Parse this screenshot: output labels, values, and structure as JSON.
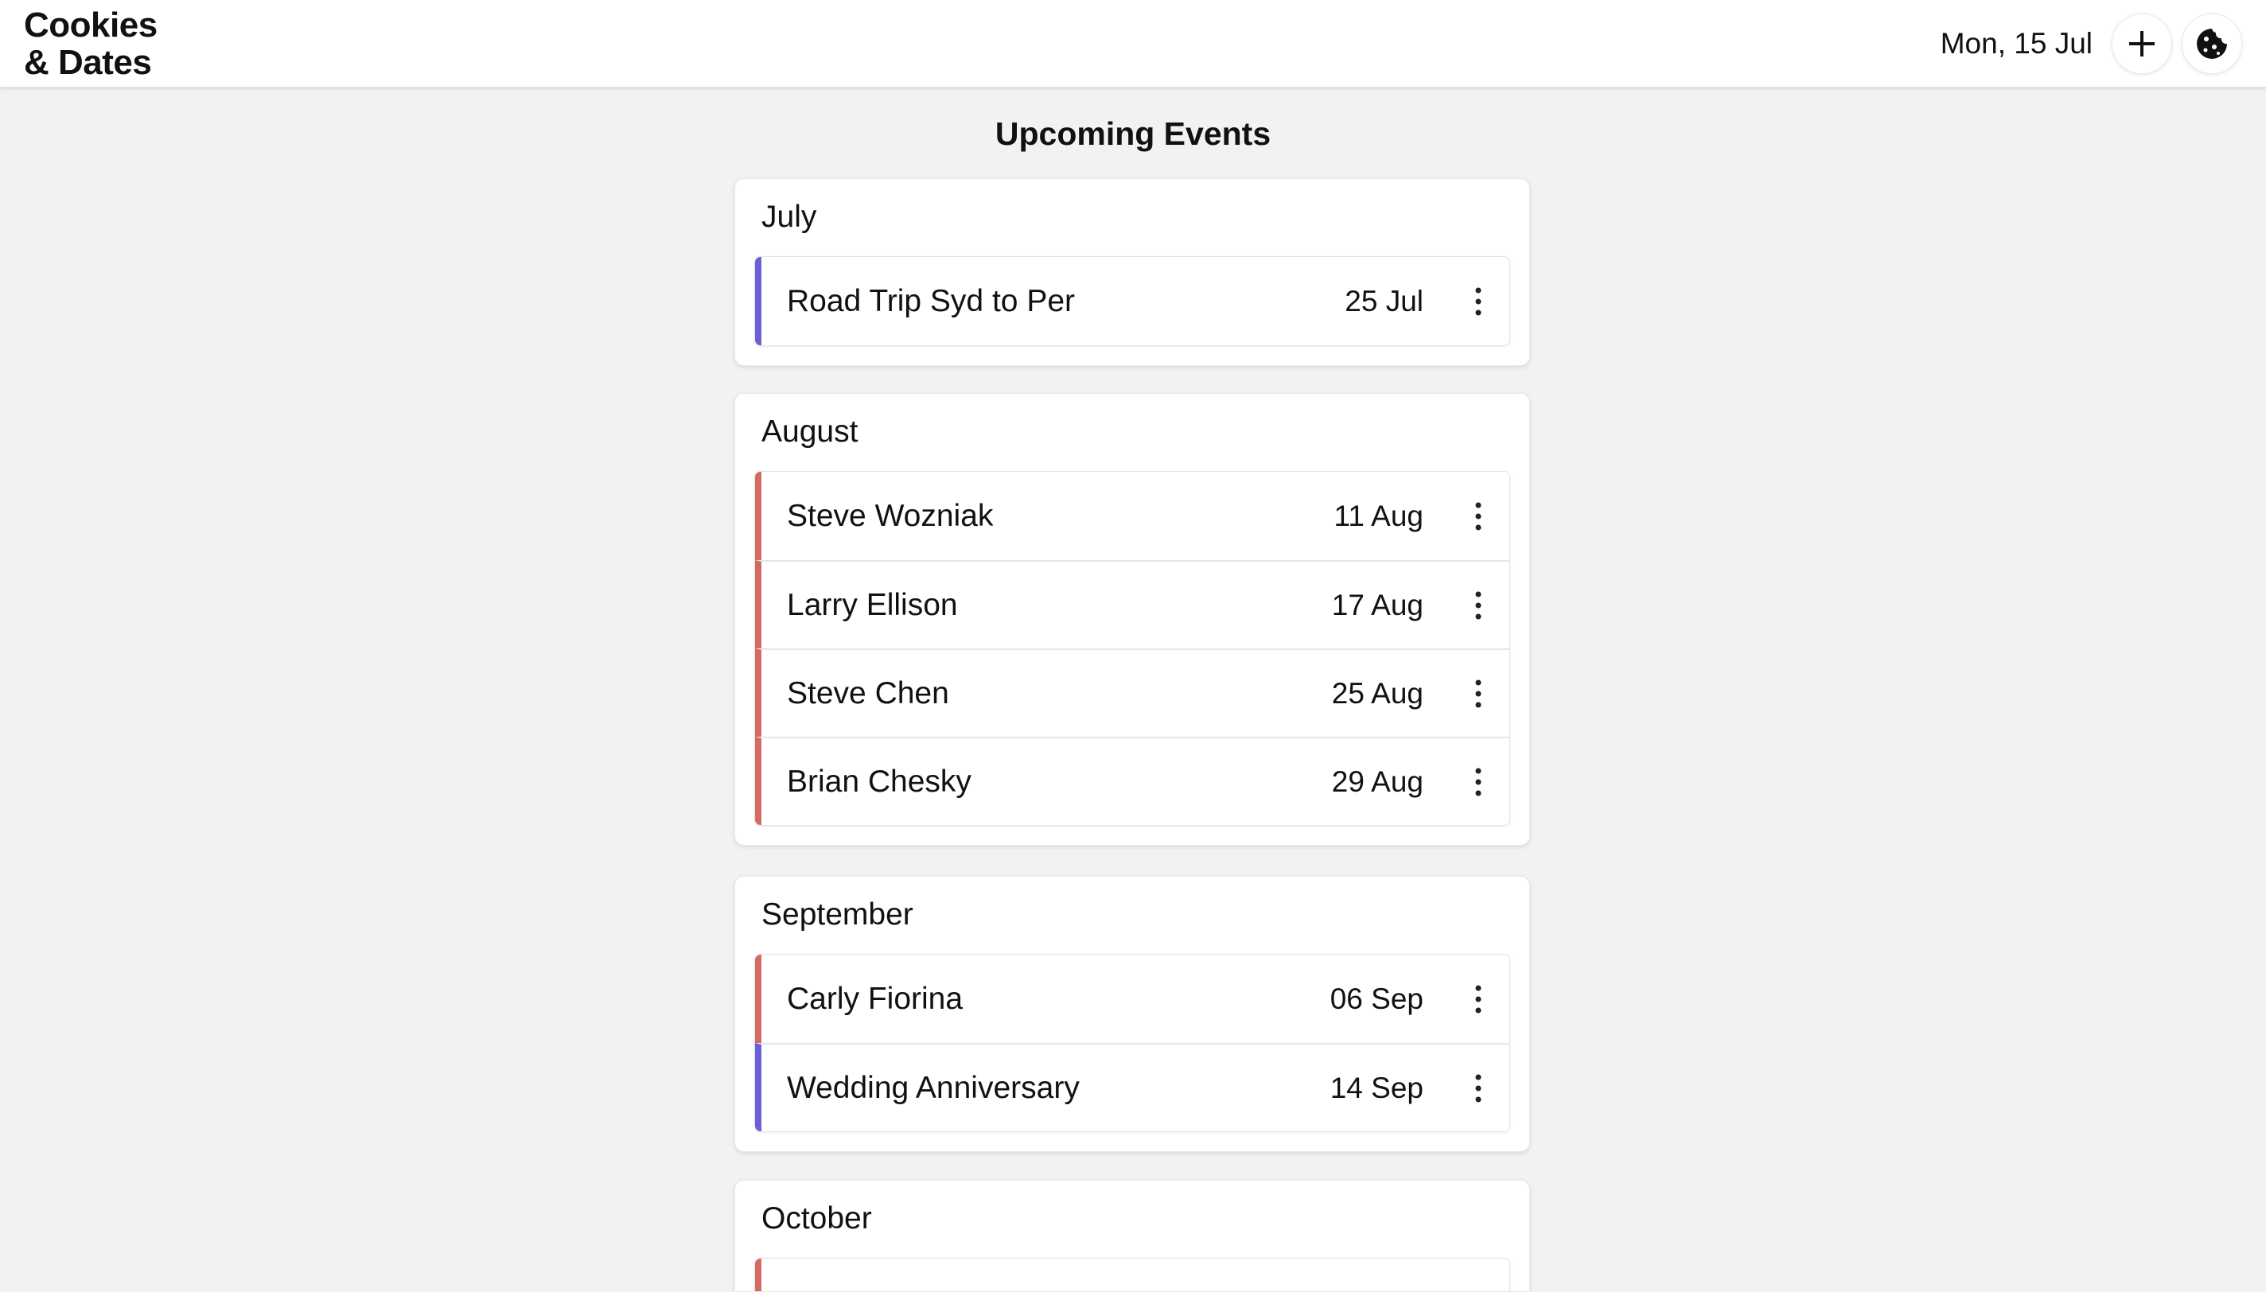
{
  "app": {
    "title_line1": "Cookies",
    "title_line2": "& Dates"
  },
  "header": {
    "current_date": "Mon, 15 Jul",
    "add_icon": "plus-icon",
    "cookie_icon": "cookie-icon"
  },
  "main": {
    "title": "Upcoming Events"
  },
  "months": [
    {
      "name": "July",
      "events": [
        {
          "name": "Road Trip Syd to Per",
          "date": "25 Jul",
          "kind": "trip"
        }
      ]
    },
    {
      "name": "August",
      "events": [
        {
          "name": "Steve Wozniak",
          "date": "11 Aug",
          "kind": "birthday"
        },
        {
          "name": "Larry Ellison",
          "date": "17 Aug",
          "kind": "birthday"
        },
        {
          "name": "Steve Chen",
          "date": "25 Aug",
          "kind": "birthday"
        },
        {
          "name": "Brian Chesky",
          "date": "29 Aug",
          "kind": "birthday"
        }
      ]
    },
    {
      "name": "September",
      "events": [
        {
          "name": "Carly Fiorina",
          "date": "06 Sep",
          "kind": "birthday"
        },
        {
          "name": "Wedding Anniversary",
          "date": "14 Sep",
          "kind": "trip"
        }
      ]
    },
    {
      "name": "October",
      "events": []
    }
  ],
  "colors": {
    "birthday_accent": "#d46a66",
    "trip_accent": "#6b5fd6",
    "background": "#f2f2f2"
  },
  "row_menu_icon": "more-vertical-icon"
}
